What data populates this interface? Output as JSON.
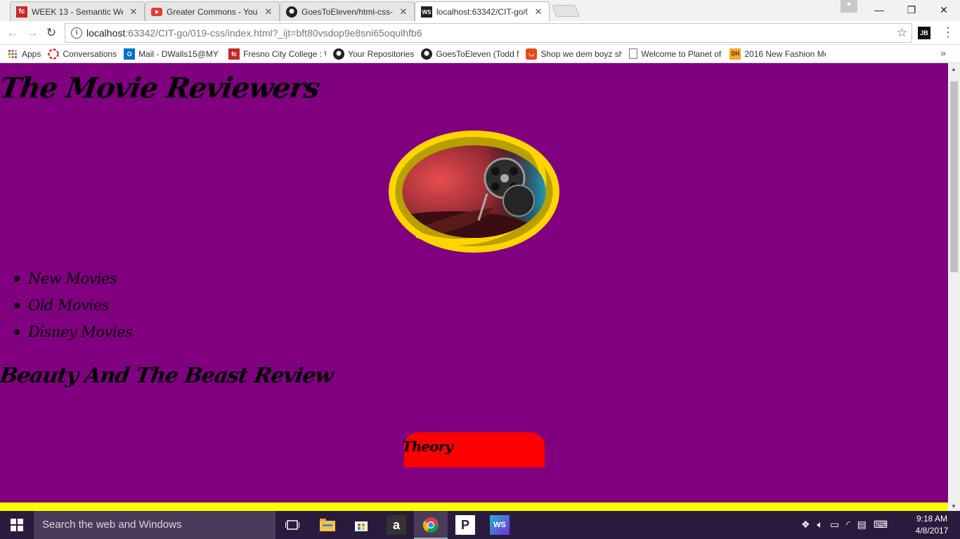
{
  "browser": {
    "tabs": [
      {
        "title": "WEEK 13 - Semantic Web",
        "favicon": "fresno-city-college-icon",
        "color": "#c62828",
        "active": false
      },
      {
        "title": "Greater Commons - YouT",
        "favicon": "youtube-icon",
        "color": "#e53935",
        "active": false
      },
      {
        "title": "GoesToEleven/html-css-l",
        "favicon": "github-icon",
        "color": "#222222",
        "active": false
      },
      {
        "title": "localhost:63342/CIT-go/0",
        "favicon": "webstorm-icon",
        "color": "#222222",
        "active": true
      }
    ],
    "url_host": "localhost",
    "url_rest": ":63342/CIT-go/019-css/index.html?_ijt=bft80vsdop9e8sni65oqulhfb6",
    "extension_label": "JB",
    "bookmarks": [
      {
        "label": "Apps",
        "icon": "apps-grid-icon",
        "color": "#4285f4"
      },
      {
        "label": "Conversations",
        "icon": "conversations-icon",
        "color": "#d32f2f"
      },
      {
        "label": "Mail - DWalls15@MY",
        "icon": "outlook-icon",
        "color": "#0072c6"
      },
      {
        "label": "Fresno City College : W",
        "icon": "fresno-city-college-icon",
        "color": "#c62828"
      },
      {
        "label": "Your Repositories",
        "icon": "github-icon",
        "color": "#222222"
      },
      {
        "label": "GoesToEleven (Todd M",
        "icon": "github-icon",
        "color": "#222222"
      },
      {
        "label": "Shop we dem boyz sh",
        "icon": "shop-icon",
        "color": "#e64a19"
      },
      {
        "label": "Welcome to Planet of",
        "icon": "page-icon",
        "color": "#ffffff"
      },
      {
        "label": "2016 New Fashion Me",
        "icon": "dh-icon",
        "color": "#f9a825"
      }
    ]
  },
  "page": {
    "background": "#800080",
    "site_title": "The Movie Reviewers",
    "nav": [
      {
        "label": "New Movies"
      },
      {
        "label": "Old Movies"
      },
      {
        "label": "Disney Movies"
      }
    ],
    "section_title": "Beauty And The Beast Review",
    "theory_label": "Theory",
    "theory_color": "#ff0000",
    "footer_color": "#ffff00"
  },
  "taskbar": {
    "search_placeholder": "Search the web and Windows",
    "time": "9:18 AM",
    "date": "4/8/2017",
    "apps": [
      {
        "name": "task-view-icon",
        "label": ""
      },
      {
        "name": "file-explorer-icon",
        "label": ""
      },
      {
        "name": "store-icon",
        "label": ""
      },
      {
        "name": "amazon-icon",
        "label": "a"
      },
      {
        "name": "chrome-icon",
        "label": ""
      },
      {
        "name": "pandora-icon",
        "label": "P"
      },
      {
        "name": "webstorm-icon",
        "label": "WS"
      }
    ]
  }
}
